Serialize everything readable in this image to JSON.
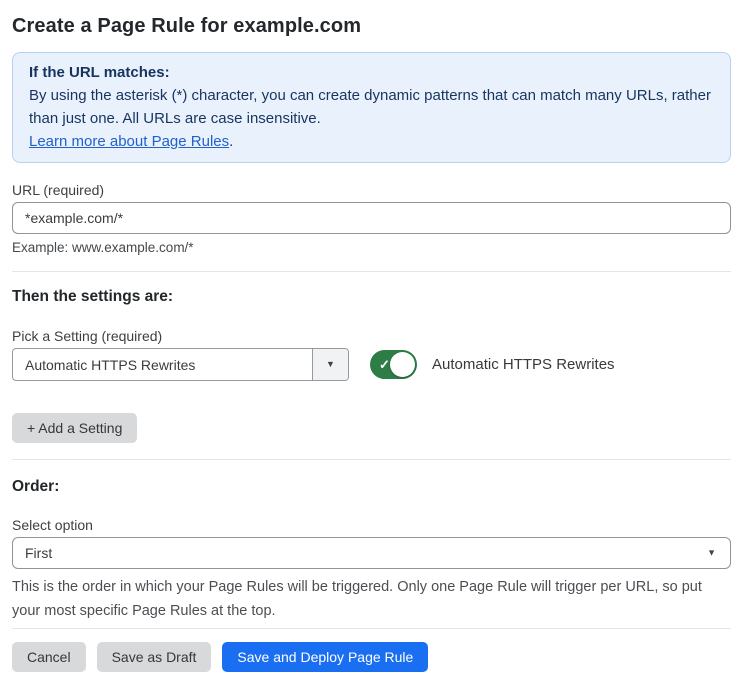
{
  "header": {
    "title": "Create a Page Rule for example.com"
  },
  "callout": {
    "title": "If the URL matches:",
    "body": "By using the asterisk (*) character, you can create dynamic patterns that can match many URLs, rather than just one. All URLs are case insensitive.",
    "link": "Learn more about Page Rules",
    "link_suffix": "."
  },
  "url_field": {
    "label": "URL (required)",
    "value": "*example.com/*",
    "hint": "Example: www.example.com/*"
  },
  "settings": {
    "heading": "Then the settings are:",
    "picker_label": "Pick a Setting (required)",
    "picker_value": "Automatic HTTPS Rewrites",
    "toggle_state": "on",
    "toggle_check": "✓",
    "toggle_label": "Automatic HTTPS Rewrites",
    "add_button": "+ Add a Setting"
  },
  "order": {
    "heading": "Order:",
    "label": "Select option",
    "value": "First",
    "hint": "This is the order in which your Page Rules will be triggered. Only one Page Rule will trigger per URL, so put your most specific Page Rules at the top."
  },
  "footer": {
    "cancel": "Cancel",
    "save_draft": "Save as Draft",
    "save_deploy": "Save and Deploy Page Rule"
  },
  "icons": {
    "chevron_down": "▼"
  },
  "colors": {
    "accent_blue": "#1a6ef2",
    "toggle_green": "#2e7d46",
    "callout_bg": "#e9f2fc",
    "callout_border": "#b5d2ee",
    "callout_text": "#17345f",
    "link_blue": "#2261c9"
  }
}
